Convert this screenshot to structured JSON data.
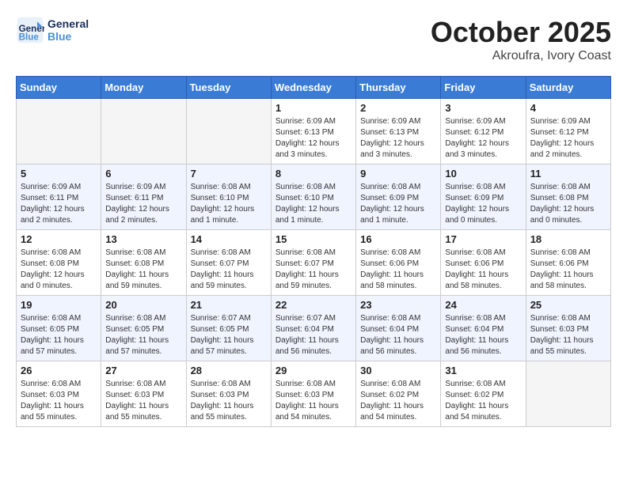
{
  "header": {
    "logo_line1": "General",
    "logo_line2": "Blue",
    "month": "October 2025",
    "location": "Akroufra, Ivory Coast"
  },
  "weekdays": [
    "Sunday",
    "Monday",
    "Tuesday",
    "Wednesday",
    "Thursday",
    "Friday",
    "Saturday"
  ],
  "weeks": [
    [
      {
        "day": "",
        "info": ""
      },
      {
        "day": "",
        "info": ""
      },
      {
        "day": "",
        "info": ""
      },
      {
        "day": "1",
        "info": "Sunrise: 6:09 AM\nSunset: 6:13 PM\nDaylight: 12 hours\nand 3 minutes."
      },
      {
        "day": "2",
        "info": "Sunrise: 6:09 AM\nSunset: 6:13 PM\nDaylight: 12 hours\nand 3 minutes."
      },
      {
        "day": "3",
        "info": "Sunrise: 6:09 AM\nSunset: 6:12 PM\nDaylight: 12 hours\nand 3 minutes."
      },
      {
        "day": "4",
        "info": "Sunrise: 6:09 AM\nSunset: 6:12 PM\nDaylight: 12 hours\nand 2 minutes."
      }
    ],
    [
      {
        "day": "5",
        "info": "Sunrise: 6:09 AM\nSunset: 6:11 PM\nDaylight: 12 hours\nand 2 minutes."
      },
      {
        "day": "6",
        "info": "Sunrise: 6:09 AM\nSunset: 6:11 PM\nDaylight: 12 hours\nand 2 minutes."
      },
      {
        "day": "7",
        "info": "Sunrise: 6:08 AM\nSunset: 6:10 PM\nDaylight: 12 hours\nand 1 minute."
      },
      {
        "day": "8",
        "info": "Sunrise: 6:08 AM\nSunset: 6:10 PM\nDaylight: 12 hours\nand 1 minute."
      },
      {
        "day": "9",
        "info": "Sunrise: 6:08 AM\nSunset: 6:09 PM\nDaylight: 12 hours\nand 1 minute."
      },
      {
        "day": "10",
        "info": "Sunrise: 6:08 AM\nSunset: 6:09 PM\nDaylight: 12 hours\nand 0 minutes."
      },
      {
        "day": "11",
        "info": "Sunrise: 6:08 AM\nSunset: 6:08 PM\nDaylight: 12 hours\nand 0 minutes."
      }
    ],
    [
      {
        "day": "12",
        "info": "Sunrise: 6:08 AM\nSunset: 6:08 PM\nDaylight: 12 hours\nand 0 minutes."
      },
      {
        "day": "13",
        "info": "Sunrise: 6:08 AM\nSunset: 6:08 PM\nDaylight: 11 hours\nand 59 minutes."
      },
      {
        "day": "14",
        "info": "Sunrise: 6:08 AM\nSunset: 6:07 PM\nDaylight: 11 hours\nand 59 minutes."
      },
      {
        "day": "15",
        "info": "Sunrise: 6:08 AM\nSunset: 6:07 PM\nDaylight: 11 hours\nand 59 minutes."
      },
      {
        "day": "16",
        "info": "Sunrise: 6:08 AM\nSunset: 6:06 PM\nDaylight: 11 hours\nand 58 minutes."
      },
      {
        "day": "17",
        "info": "Sunrise: 6:08 AM\nSunset: 6:06 PM\nDaylight: 11 hours\nand 58 minutes."
      },
      {
        "day": "18",
        "info": "Sunrise: 6:08 AM\nSunset: 6:06 PM\nDaylight: 11 hours\nand 58 minutes."
      }
    ],
    [
      {
        "day": "19",
        "info": "Sunrise: 6:08 AM\nSunset: 6:05 PM\nDaylight: 11 hours\nand 57 minutes."
      },
      {
        "day": "20",
        "info": "Sunrise: 6:08 AM\nSunset: 6:05 PM\nDaylight: 11 hours\nand 57 minutes."
      },
      {
        "day": "21",
        "info": "Sunrise: 6:07 AM\nSunset: 6:05 PM\nDaylight: 11 hours\nand 57 minutes."
      },
      {
        "day": "22",
        "info": "Sunrise: 6:07 AM\nSunset: 6:04 PM\nDaylight: 11 hours\nand 56 minutes."
      },
      {
        "day": "23",
        "info": "Sunrise: 6:08 AM\nSunset: 6:04 PM\nDaylight: 11 hours\nand 56 minutes."
      },
      {
        "day": "24",
        "info": "Sunrise: 6:08 AM\nSunset: 6:04 PM\nDaylight: 11 hours\nand 56 minutes."
      },
      {
        "day": "25",
        "info": "Sunrise: 6:08 AM\nSunset: 6:03 PM\nDaylight: 11 hours\nand 55 minutes."
      }
    ],
    [
      {
        "day": "26",
        "info": "Sunrise: 6:08 AM\nSunset: 6:03 PM\nDaylight: 11 hours\nand 55 minutes."
      },
      {
        "day": "27",
        "info": "Sunrise: 6:08 AM\nSunset: 6:03 PM\nDaylight: 11 hours\nand 55 minutes."
      },
      {
        "day": "28",
        "info": "Sunrise: 6:08 AM\nSunset: 6:03 PM\nDaylight: 11 hours\nand 55 minutes."
      },
      {
        "day": "29",
        "info": "Sunrise: 6:08 AM\nSunset: 6:03 PM\nDaylight: 11 hours\nand 54 minutes."
      },
      {
        "day": "30",
        "info": "Sunrise: 6:08 AM\nSunset: 6:02 PM\nDaylight: 11 hours\nand 54 minutes."
      },
      {
        "day": "31",
        "info": "Sunrise: 6:08 AM\nSunset: 6:02 PM\nDaylight: 11 hours\nand 54 minutes."
      },
      {
        "day": "",
        "info": ""
      }
    ]
  ]
}
